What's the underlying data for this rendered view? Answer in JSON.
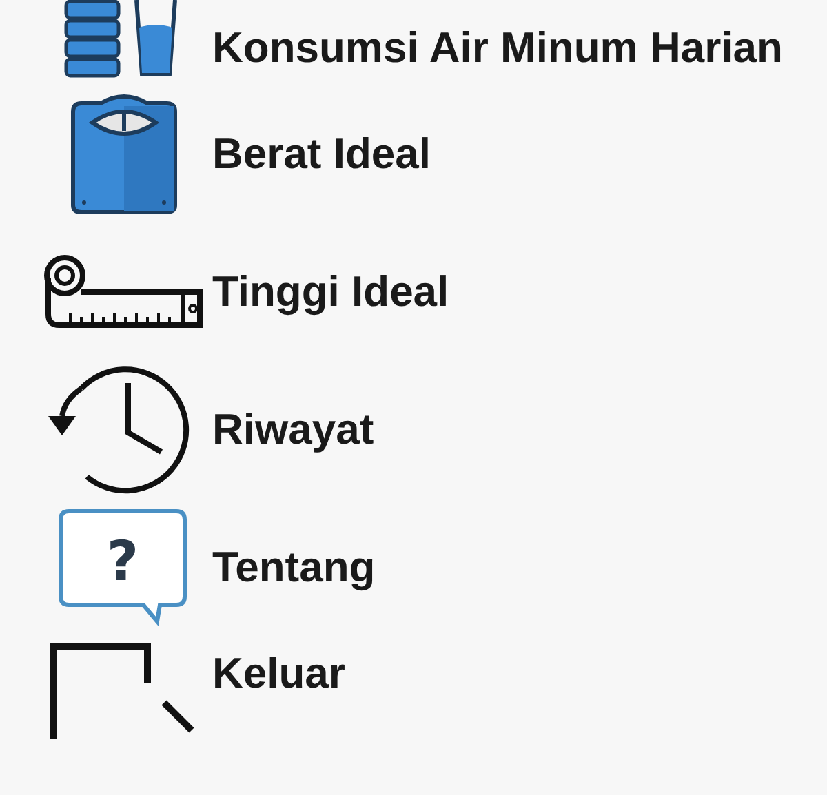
{
  "menu": [
    {
      "kind": "water",
      "label": "Konsumsi Air Minum Harian"
    },
    {
      "kind": "scale",
      "label": "Berat Ideal"
    },
    {
      "kind": "tape",
      "label": "Tinggi Ideal"
    },
    {
      "kind": "history",
      "label": "Riwayat"
    },
    {
      "kind": "help",
      "glyph": "?",
      "label": "Tentang"
    },
    {
      "kind": "exit",
      "label": "Keluar"
    }
  ]
}
